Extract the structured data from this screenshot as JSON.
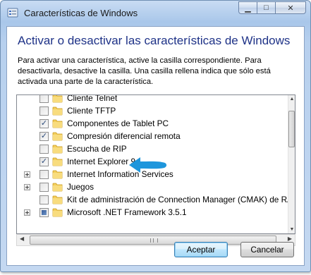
{
  "window": {
    "title": "Características de Windows"
  },
  "main": {
    "heading": "Activar o desactivar las características de Windows",
    "description": "Para activar una característica, active la casilla correspondiente. Para desactivarla, desactive la casilla. Una casilla rellena indica que sólo está activada una parte de la característica."
  },
  "features": [
    {
      "label": "Cliente Telnet",
      "state": "unchecked",
      "expandable": false
    },
    {
      "label": "Cliente TFTP",
      "state": "unchecked",
      "expandable": false
    },
    {
      "label": "Componentes de Tablet PC",
      "state": "checked",
      "expandable": false
    },
    {
      "label": "Compresión diferencial remota",
      "state": "checked",
      "expandable": false
    },
    {
      "label": "Escucha de RIP",
      "state": "unchecked",
      "expandable": false
    },
    {
      "label": "Internet Explorer 9",
      "state": "checked",
      "expandable": false
    },
    {
      "label": "Internet Information Services",
      "state": "unchecked",
      "expandable": true
    },
    {
      "label": "Juegos",
      "state": "unchecked",
      "expandable": true
    },
    {
      "label": "Kit de administración de Connection Manager (CMAK) de RAS",
      "state": "unchecked",
      "expandable": false
    },
    {
      "label": "Microsoft .NET Framework 3.5.1",
      "state": "partial",
      "expandable": true
    }
  ],
  "buttons": {
    "ok": "Aceptar",
    "cancel": "Cancelar"
  },
  "glyphs": {
    "check": "✓",
    "minimize": "▁",
    "maximize": "□",
    "close": "✕"
  },
  "colors": {
    "heading": "#1e3287",
    "annotation_arrow": "#1e96dc",
    "folder": "#f0c44c"
  }
}
